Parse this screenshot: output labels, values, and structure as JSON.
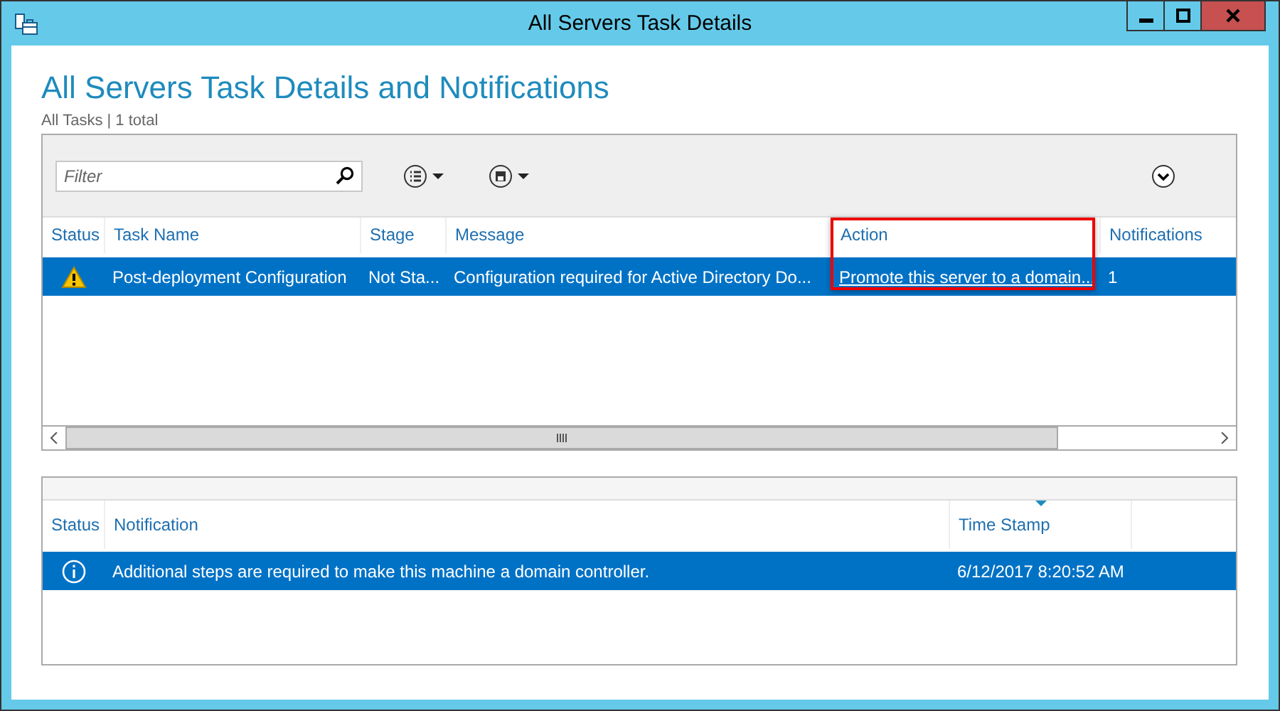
{
  "window": {
    "title": "All Servers Task Details"
  },
  "heading": "All Servers Task Details and Notifications",
  "subheading": "All Tasks | 1 total",
  "tasks": {
    "filter": {
      "placeholder": "Filter"
    },
    "columns": [
      {
        "label": "Status"
      },
      {
        "label": "Task Name"
      },
      {
        "label": "Stage"
      },
      {
        "label": "Message"
      },
      {
        "label": "Action",
        "highlighted": true
      },
      {
        "label": "Notifications"
      }
    ],
    "rows": [
      {
        "kind": "warning",
        "task_name": "Post-deployment Configuration",
        "stage": "Not Sta...",
        "message": "Configuration required for Active Directory Do...",
        "action": "Promote this server to a domain...",
        "notifications": "1",
        "selected": true
      }
    ]
  },
  "notifications": {
    "columns": [
      {
        "label": "Status",
        "sorted": false
      },
      {
        "label": "Notification",
        "sorted": false
      },
      {
        "label": "Time Stamp",
        "sorted": true
      }
    ],
    "rows": [
      {
        "kind": "info",
        "notification": "Additional steps are required to make this machine a domain controller.",
        "time_stamp": "6/12/2017 8:20:52 AM",
        "selected": true
      }
    ]
  }
}
